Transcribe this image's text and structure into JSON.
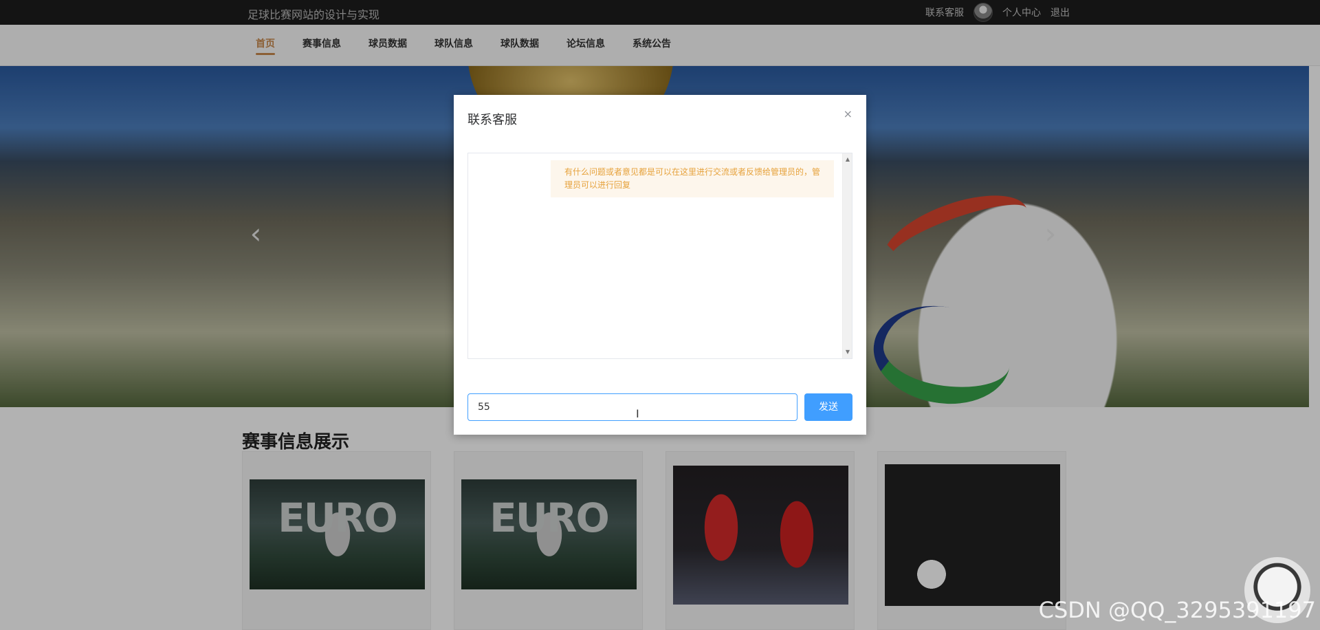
{
  "topbar": {
    "site_title": "足球比赛网站的设计与实现",
    "contact": "联系客服",
    "profile": "个人中心",
    "logout": "退出"
  },
  "nav": {
    "items": [
      {
        "label": "首页",
        "active": true
      },
      {
        "label": "赛事信息"
      },
      {
        "label": "球员数据"
      },
      {
        "label": "球队信息"
      },
      {
        "label": "球队数据"
      },
      {
        "label": "论坛信息"
      },
      {
        "label": "系统公告"
      }
    ]
  },
  "banner": {
    "prev_icon": "chevron-left-icon",
    "next_icon": "chevron-right-icon",
    "prev_glyph": "‹",
    "next_glyph": "›"
  },
  "section": {
    "title": "赛事信息展示",
    "cards": [
      {
        "image": "euro-2012-poster",
        "image_text": "EURO"
      },
      {
        "image": "euro-2012-poster",
        "image_text": "EURO"
      },
      {
        "image": "manchester-united-players"
      },
      {
        "image": "player-kicking-ball"
      }
    ]
  },
  "modal": {
    "title": "联系客服",
    "close_glyph": "×",
    "message": "有什么问题或者意见都是可以在这里进行交流或者反馈给管理员的，管理员可以进行回复",
    "input_value": "55",
    "send_label": "发送",
    "cursor_glyph": "I"
  },
  "watermark": "CSDN @QQ_3295391197",
  "colors": {
    "accent": "#c8894d",
    "primary": "#409eff",
    "warning_text": "#e6a23c",
    "warning_bg": "#fdf6ec",
    "topbar_bg": "#1d1d1d"
  }
}
